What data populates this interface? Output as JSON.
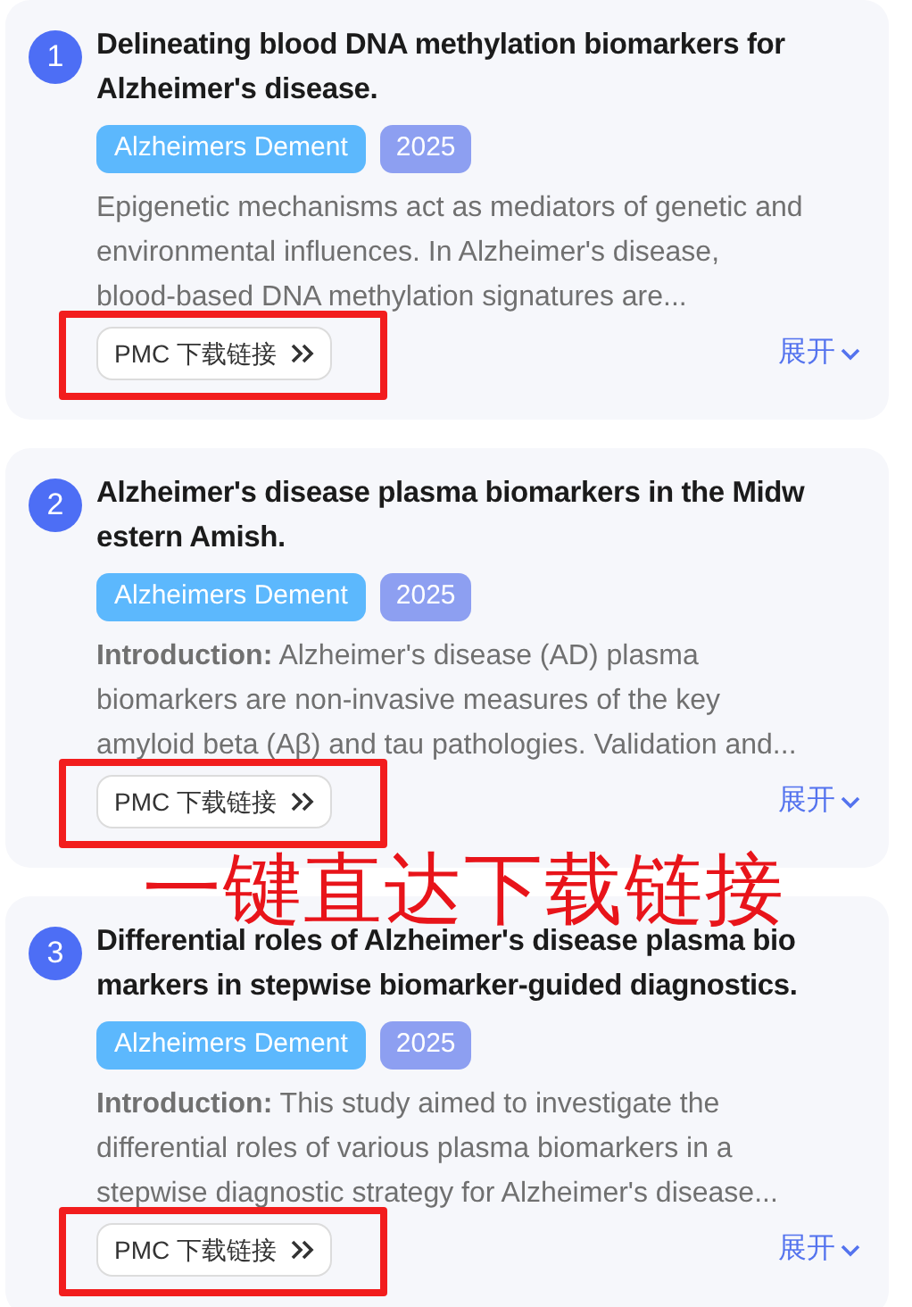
{
  "articles": [
    {
      "number": "1",
      "title_lines": [
        "Delineating blood DNA methylation biomarkers for",
        "Alzheimer's disease."
      ],
      "journal": "Alzheimers Dement",
      "year": "2025",
      "abstract_lines": [
        "Epigenetic mechanisms act as mediators of genetic and",
        "environmental influences. In Alzheimer's disease,",
        "blood-based DNA methylation signatures are..."
      ],
      "download_label": "PMC 下载链接",
      "expand_label": "展开",
      "highlighted": true
    },
    {
      "number": "2",
      "title_lines": [
        "Alzheimer's disease plasma biomarkers in the Midw",
        "estern Amish."
      ],
      "journal": "Alzheimers Dement",
      "year": "2025",
      "abstract_lines": [
        "**Introduction:** Alzheimer's disease (AD) plasma",
        "biomarkers are non-invasive measures of the key",
        "amyloid beta (Aβ) and tau pathologies. Validation and..."
      ],
      "download_label": "PMC 下载链接",
      "expand_label": "展开",
      "highlighted": true
    },
    {
      "number": "3",
      "title_lines": [
        "Differential roles of Alzheimer's disease plasma bio",
        "markers in stepwise biomarker-guided diagnostics."
      ],
      "journal": "Alzheimers Dement",
      "year": "2025",
      "abstract_lines": [
        "**Introduction:** This study aimed to investigate the",
        "differential roles of various plasma biomarkers in a",
        "stepwise diagnostic strategy for Alzheimer's disease..."
      ],
      "download_label": "PMC 下载链接",
      "expand_label": "展开",
      "highlighted": true
    }
  ],
  "annotation": {
    "caption": "一键直达下载链接"
  }
}
